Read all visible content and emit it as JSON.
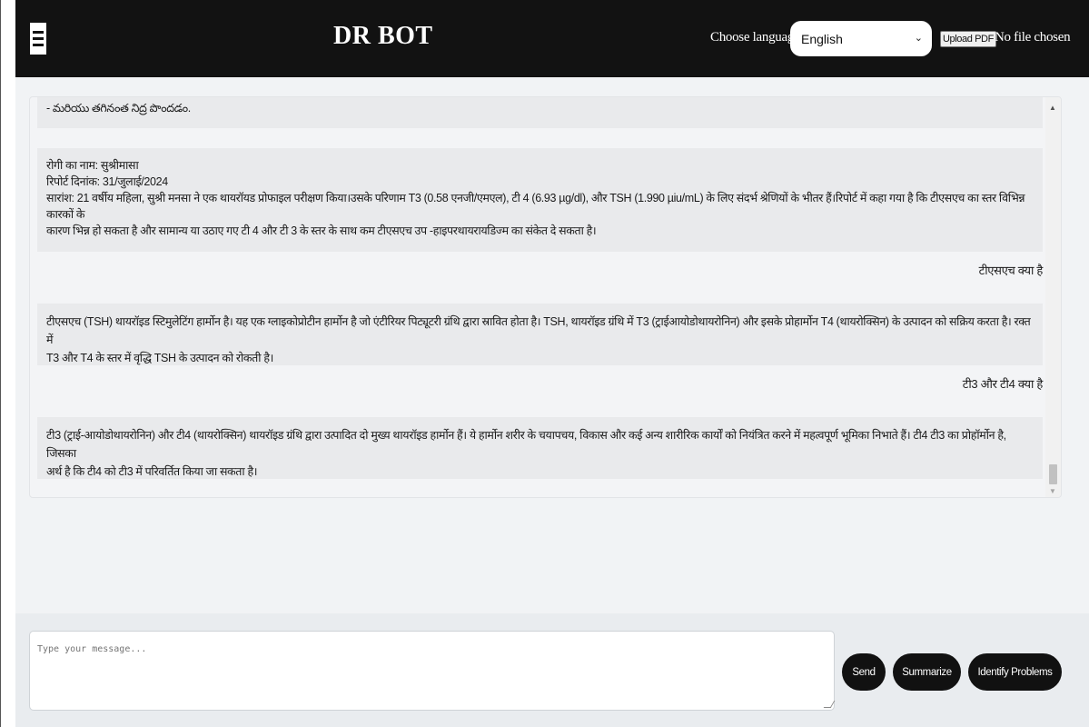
{
  "header": {
    "title": "DR BOT",
    "language_label": "Choose language",
    "language_selected": "English",
    "upload_label": "Upload PDF",
    "file_status": "No file chosen"
  },
  "chat": {
    "messages": [
      {
        "role": "bot",
        "lines": [
          "- మరియు తగినంత నిద్ర పొందడం."
        ]
      },
      {
        "role": "bot",
        "lines": [
          "रोगी का नाम: सुश्रीमासा",
          "रिपोर्ट दिनांक: 31/जुलाई/2024",
          "सारांश: 21 वर्षीय महिला, सुश्री मनसा ने एक थायरॉयड प्रोफाइल परीक्षण किया।उसके परिणाम T3 (0.58 एनजी/एमएल), टी 4 (6.93 µg/dl), और TSH (1.990 µiu/mL) के लिए संदर्भ श्रेणियों के भीतर हैं।रिपोर्ट में कहा गया है कि टीएसएच का स्तर विभिन्न कारकों के",
          "कारण भिन्न हो सकता है और सामान्य या उठाए गए टी 4 और टी 3 के स्तर के साथ कम टीएसएच उप -हाइपरथायरायडिज्म का संकेत दे सकता है।"
        ]
      },
      {
        "role": "user",
        "text": "टीएसएच क्या है"
      },
      {
        "role": "bot",
        "lines": [
          "टीएसएच (TSH) थायरॉइड स्टिमुलेटिंग हार्मोन है। यह एक ग्लाइकोप्रोटीन हार्मोन है जो एंटीरियर पिट्यूटरी ग्रंथि द्वारा स्रावित होता है।  TSH, थायरॉइड ग्रंथि में T3 (ट्राईआयोडोथायरोनिन) और इसके प्रोहार्मोन T4 (थायरोक्सिन) के उत्पादन को सक्रिय करता है।  रक्त में",
          "T3 और T4 के स्तर में वृद्धि TSH के उत्पादन को रोकती है।"
        ]
      },
      {
        "role": "user",
        "text": "टी3 और टी4 क्या है"
      },
      {
        "role": "bot",
        "lines": [
          "टी3 (ट्राई-आयोडोथायरोनिन) और टी4 (थायरोक्सिन) थायरॉइड ग्रंथि द्वारा उत्पादित दो मुख्य थायरॉइड हार्मोन हैं। ये हार्मोन शरीर के चयापचय, विकास और कई अन्य शारीरिक कार्यों को नियंत्रित करने में महत्वपूर्ण भूमिका निभाते हैं।  टी4 टी3 का प्रोहॉर्मोन है, जिसका",
          "अर्थ है कि टी4 को टी3 में परिवर्तित किया जा सकता है।"
        ]
      }
    ]
  },
  "composer": {
    "placeholder": "Type your message...",
    "send_label": "Send",
    "summarize_label": "Summarize",
    "identify_label": "Identify Problems"
  },
  "icons": {
    "menu": "hamburger-menu-icon",
    "dropdown": "chevron-down-icon",
    "scroll_up": "triangle-up-icon",
    "scroll_down": "triangle-down-icon"
  },
  "colors": {
    "header_bg": "#121212",
    "button_bg": "#111111",
    "bot_bubble": "#e9eaec",
    "page_bg": "#f1f3f5"
  }
}
